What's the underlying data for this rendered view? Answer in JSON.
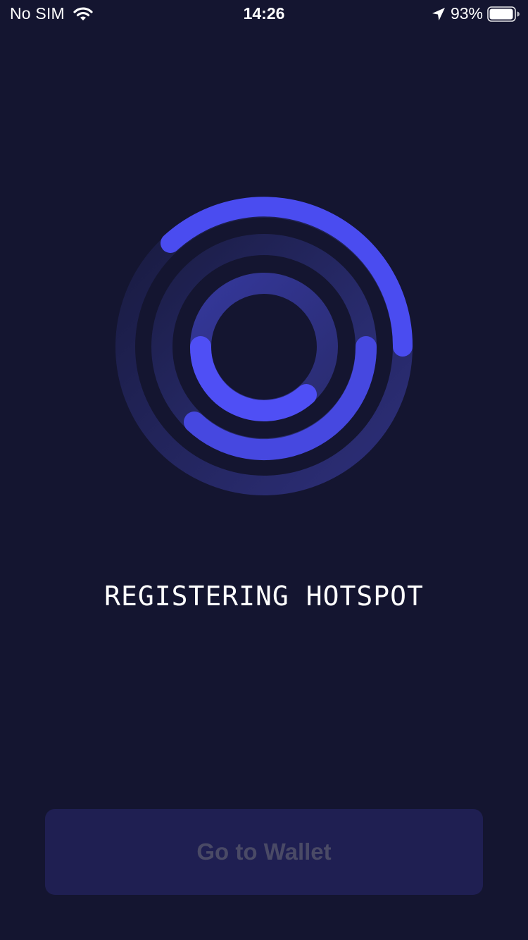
{
  "status_bar": {
    "carrier": "No SIM",
    "time": "14:26",
    "battery_percent": "93%",
    "battery_level": 0.93,
    "icons": [
      "wifi-icon",
      "location-arrow-icon",
      "battery-icon"
    ]
  },
  "spinner": {
    "icon": "loading-rings-icon",
    "colors": {
      "accent": "#4f4ff5",
      "track_outer": "#24265e",
      "track_mid": "#2c2f72",
      "track_inner": "#33358a"
    }
  },
  "screen": {
    "title": "REGISTERING HOTSPOT"
  },
  "actions": {
    "go_to_wallet_label": "Go to Wallet",
    "go_to_wallet_state": "disabled"
  },
  "theme": {
    "background": "#141530",
    "button_bg": "#1f1f52",
    "button_text": "#4a4a66",
    "text": "#ffffff"
  }
}
